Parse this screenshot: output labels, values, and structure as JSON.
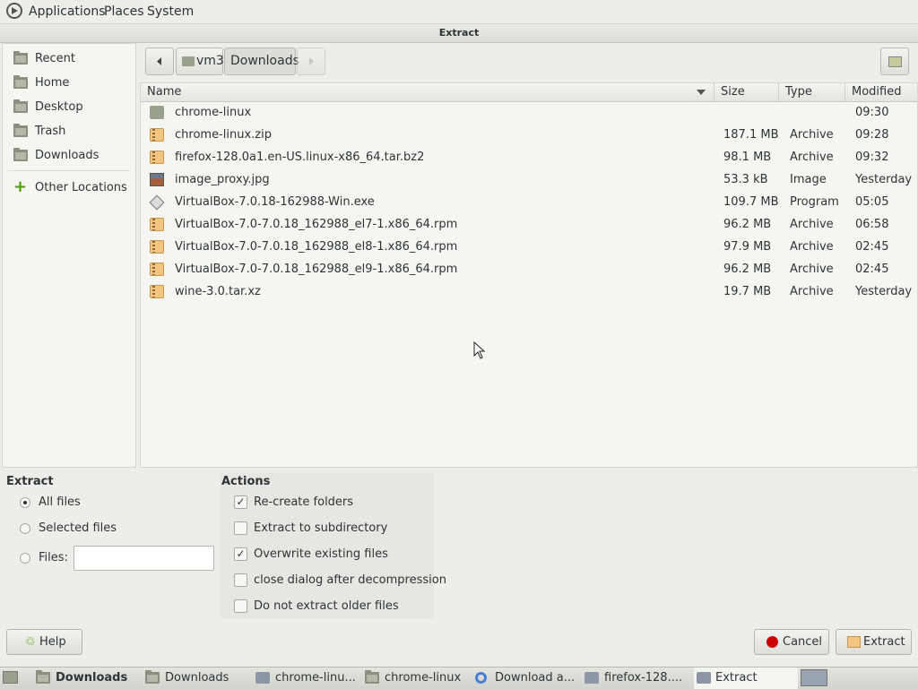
{
  "top_panel": {
    "menus": [
      "Applications",
      "Places",
      "System"
    ]
  },
  "window": {
    "title": "Extract"
  },
  "sidebar": {
    "items": [
      {
        "label": "Recent",
        "icon": "recent-icon"
      },
      {
        "label": "Home",
        "icon": "home-icon"
      },
      {
        "label": "Desktop",
        "icon": "desktop-icon"
      },
      {
        "label": "Trash",
        "icon": "trash-icon"
      },
      {
        "label": "Downloads",
        "icon": "folder-icon"
      },
      {
        "label": "Other Locations",
        "icon": "plus-icon"
      }
    ]
  },
  "path": {
    "segments": [
      "vm3",
      "Downloads"
    ],
    "current": "Downloads"
  },
  "columns": {
    "name": "Name",
    "size": "Size",
    "type": "Type",
    "modified": "Modified"
  },
  "files": [
    {
      "name": "chrome-linux",
      "size": "",
      "type": "",
      "modified": "09:30",
      "kind": "folder"
    },
    {
      "name": "chrome-linux.zip",
      "size": "187.1 MB",
      "type": "Archive",
      "modified": "09:28",
      "kind": "archive"
    },
    {
      "name": "firefox-128.0a1.en-US.linux-x86_64.tar.bz2",
      "size": "98.1 MB",
      "type": "Archive",
      "modified": "09:32",
      "kind": "archive"
    },
    {
      "name": "image_proxy.jpg",
      "size": "53.3 kB",
      "type": "Image",
      "modified": "Yesterday",
      "kind": "image"
    },
    {
      "name": "VirtualBox-7.0.18-162988-Win.exe",
      "size": "109.7 MB",
      "type": "Program",
      "modified": "05:05",
      "kind": "program"
    },
    {
      "name": "VirtualBox-7.0-7.0.18_162988_el7-1.x86_64.rpm",
      "size": "96.2 MB",
      "type": "Archive",
      "modified": "06:58",
      "kind": "archive"
    },
    {
      "name": "VirtualBox-7.0-7.0.18_162988_el8-1.x86_64.rpm",
      "size": "97.9 MB",
      "type": "Archive",
      "modified": "02:45",
      "kind": "archive"
    },
    {
      "name": "VirtualBox-7.0-7.0.18_162988_el9-1.x86_64.rpm",
      "size": "96.2 MB",
      "type": "Archive",
      "modified": "02:45",
      "kind": "archive"
    },
    {
      "name": "wine-3.0.tar.xz",
      "size": "19.7 MB",
      "type": "Archive",
      "modified": "Yesterday",
      "kind": "archive"
    }
  ],
  "extract": {
    "heading": "Extract",
    "all_files": "All files",
    "selected_files": "Selected files",
    "files_label": "Files:",
    "files_value": "",
    "selected": "all"
  },
  "actions": {
    "heading": "Actions",
    "recreate_folders": {
      "label": "Re-create folders",
      "checked": true
    },
    "extract_subdir": {
      "label": "Extract to subdirectory",
      "checked": false
    },
    "overwrite": {
      "label": "Overwrite existing files",
      "checked": true
    },
    "close_dialog": {
      "label": "close dialog after decompression",
      "checked": false
    },
    "no_older": {
      "label": "Do not extract older files",
      "checked": false
    }
  },
  "buttons": {
    "help": "Help",
    "cancel": "Cancel",
    "extract": "Extract"
  },
  "taskbar": {
    "items": [
      "Downloads",
      "Downloads",
      "chrome-linu...",
      "chrome-linux",
      "Download a...",
      "firefox-128....",
      "Extract"
    ]
  },
  "colors": {
    "background": "#edeee9",
    "cancel_red": "#cc0000",
    "archive_orange": "#f3c583"
  }
}
